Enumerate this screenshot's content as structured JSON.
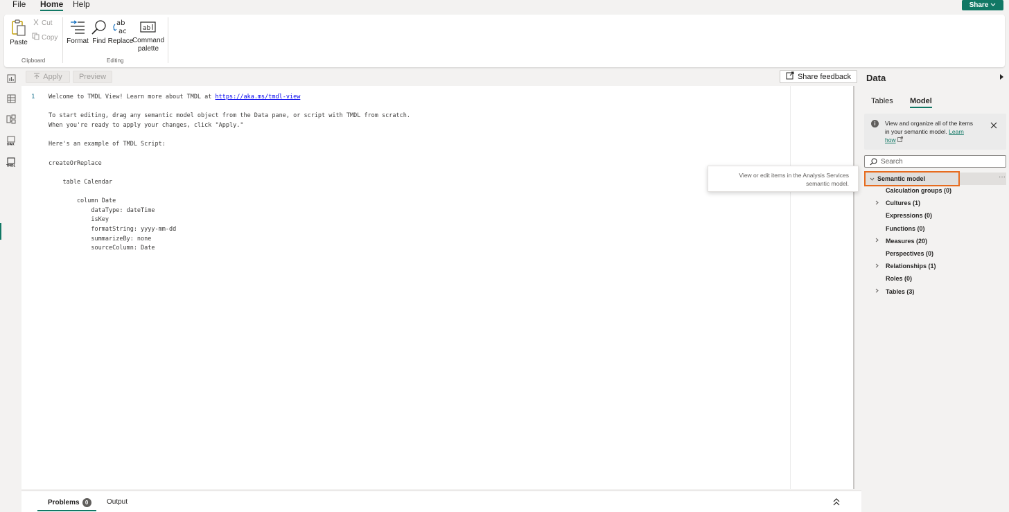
{
  "menu": {
    "file": "File",
    "home": "Home",
    "help": "Help",
    "share": "Share"
  },
  "ribbon": {
    "paste": "Paste",
    "cut": "Cut",
    "copy": "Copy",
    "clipboard_group": "Clipboard",
    "format": "Format",
    "find": "Find",
    "replace": "Replace",
    "command_line1": "Command",
    "command_line2": "palette",
    "editing_group": "Editing"
  },
  "toolbar": {
    "apply": "Apply",
    "preview": "Preview",
    "share_feedback": "Share feedback"
  },
  "editor": {
    "line_number": "1",
    "welcome_prefix": "Welcome to TMDL View! Learn more about TMDL at ",
    "welcome_link": "https://aka.ms/tmdl-view",
    "line2": "To start editing, drag any semantic model object from the Data pane, or script with TMDL from scratch.",
    "line3": "When you're ready to apply your changes, click \"Apply.\"",
    "line4": "Here's an example of TMDL Script:",
    "line5": "createOrReplace",
    "line6": "    table Calendar",
    "line7": "        column Date",
    "line8": "            dataType: dateTime",
    "line9": "            isKey",
    "line10": "            formatString: yyyy-mm-dd",
    "line11": "            summarizeBy: none",
    "line12": "            sourceColumn: Date"
  },
  "bottom": {
    "problems": "Problems",
    "problems_count": "0",
    "output": "Output"
  },
  "data_pane": {
    "title": "Data",
    "tab_tables": "Tables",
    "tab_model": "Model",
    "info_text": "View and organize all of the items in your semantic model.",
    "info_link": "Learn how",
    "search_placeholder": "Search",
    "tree_root": "Semantic model",
    "items": [
      {
        "label": "Calculation groups (0)",
        "expandable": false
      },
      {
        "label": "Cultures (1)",
        "expandable": true
      },
      {
        "label": "Expressions (0)",
        "expandable": false
      },
      {
        "label": "Functions (0)",
        "expandable": false
      },
      {
        "label": "Measures (20)",
        "expandable": true
      },
      {
        "label": "Perspectives (0)",
        "expandable": false
      },
      {
        "label": "Relationships (1)",
        "expandable": true
      },
      {
        "label": "Roles (0)",
        "expandable": false
      },
      {
        "label": "Tables (3)",
        "expandable": true
      }
    ]
  },
  "tooltip": {
    "line1": "View or edit items in the Analysis Services",
    "line2": "semantic model."
  },
  "colors": {
    "accent": "#117865",
    "highlight": "#e76b1e"
  }
}
